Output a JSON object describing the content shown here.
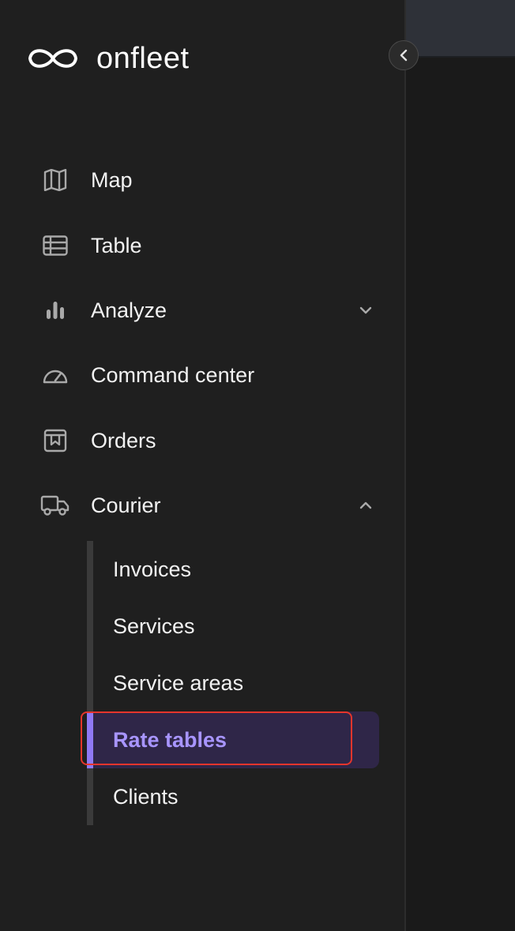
{
  "brand": {
    "name": "onfleet"
  },
  "nav": {
    "items": [
      {
        "label": "Map",
        "icon": "map-icon"
      },
      {
        "label": "Table",
        "icon": "table-icon"
      },
      {
        "label": "Analyze",
        "icon": "bar-chart-icon",
        "expanded": false
      },
      {
        "label": "Command center",
        "icon": "gauge-icon"
      },
      {
        "label": "Orders",
        "icon": "orders-icon"
      },
      {
        "label": "Courier",
        "icon": "truck-icon",
        "expanded": true
      }
    ],
    "courier_submenu": [
      {
        "label": "Invoices"
      },
      {
        "label": "Services"
      },
      {
        "label": "Service areas"
      },
      {
        "label": "Rate tables",
        "active": true
      },
      {
        "label": "Clients"
      }
    ]
  },
  "colors": {
    "accent": "#8f78f5",
    "active_text": "#a895ff",
    "highlight": "#e5352c"
  }
}
